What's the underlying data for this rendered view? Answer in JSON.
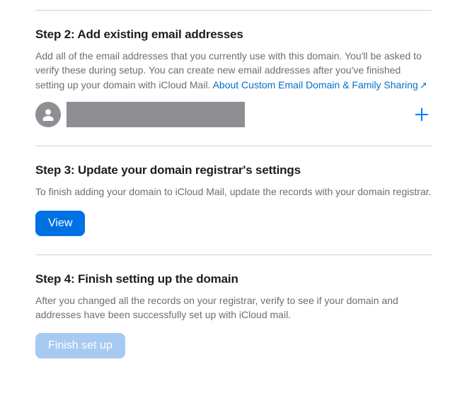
{
  "step2": {
    "title": "Step 2: Add existing email addresses",
    "desc": "Add all of the email addresses that you currently use with this domain. You'll be asked to verify these during setup. You can create new email addresses after you've finished setting up your domain with iCloud Mail. ",
    "link_text": "About Custom Email Domain & Family Sharing",
    "link_arrow": "↗"
  },
  "step3": {
    "title": "Step 3: Update your domain registrar's settings",
    "desc": "To finish adding your domain to iCloud Mail, update the records with your domain registrar.",
    "button": "View"
  },
  "step4": {
    "title": "Step 4: Finish setting up the domain",
    "desc": "After you changed all the records on your registrar, verify to see if your domain and addresses have been successfully set up with iCloud mail.",
    "button": "Finish set up"
  }
}
